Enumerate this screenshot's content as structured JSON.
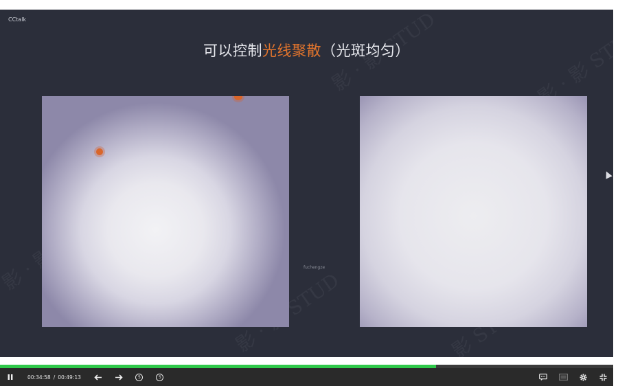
{
  "app": {
    "brand": "CCtalk"
  },
  "slide": {
    "title_prefix": "可以控制",
    "title_accent": "光线聚散",
    "title_suffix": "（光斑均匀）",
    "center_label": "fuchengze"
  },
  "watermark": {
    "text": "影 · 影 STUD"
  },
  "player": {
    "current_time": "00:34:58",
    "separator": "/",
    "total_time": "00:49:13",
    "progress_fraction": 0.711,
    "colors": {
      "progress": "#2fc84a",
      "bar": "#2a2a2a",
      "accent": "#e0742d"
    },
    "icons": {
      "play_pause": "pause-icon",
      "back": "arrow-left-icon",
      "forward": "arrow-right-icon",
      "rewind": "rewind-5-icon",
      "skip": "forward-5-icon",
      "captions": "captions-icon",
      "screen": "screen-icon",
      "settings": "gear-icon",
      "exit_fullscreen": "exit-fullscreen-icon"
    },
    "rewind_label": "5",
    "skip_label": "5"
  }
}
